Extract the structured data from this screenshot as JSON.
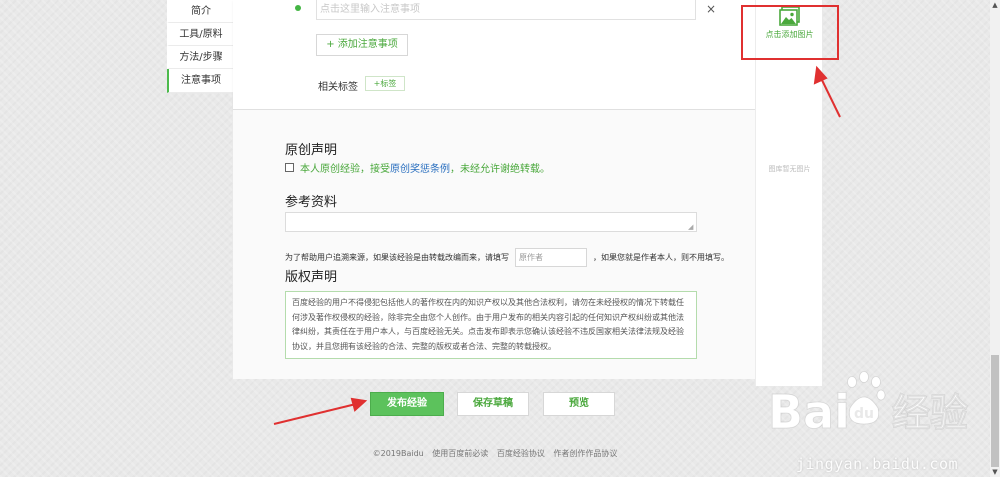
{
  "left_nav": {
    "items": [
      {
        "label": "简介"
      },
      {
        "label": "工具/原料"
      },
      {
        "label": "方法/步骤"
      },
      {
        "label": "注意事项"
      }
    ]
  },
  "editor": {
    "note_placeholder": "点击这里输入注意事项",
    "close_glyph": "×",
    "add_note_label": "+ 添加注意事项",
    "tags_label": "相关标签",
    "add_tag_label": "+标签"
  },
  "original": {
    "title": "原创声明",
    "text_before": "本人原创经验，接受",
    "link_text": "原创奖惩条例",
    "text_after": "，未经允许谢绝转载。"
  },
  "reference": {
    "title": "参考资料",
    "source_before": "为了帮助用户追溯来源，如果该经验是由转载改编而来，请填写",
    "author_placeholder": "原作者",
    "source_after": "，如果您就是作者本人，则不用填写。"
  },
  "copyright": {
    "title": "版权声明",
    "text": "百度经验的用户不得侵犯包括他人的著作权在内的知识产权以及其他合法权利，请勿在未经授权的情况下转载任何涉及著作权侵权的经验，除非完全由您个人创作。由于用户发布的相关内容引起的任何知识产权纠纷或其他法律纠纷，其责任在于用户本人，与百度经验无关。点击发布即表示您确认该经验不违反国家相关法律法规及经验协议，并且您拥有该经验的合法、完整的版权或者合法、完整的转载授权。"
  },
  "sidebar": {
    "add_image_label": "点击添加图片",
    "no_image_text": "图库暂无图片"
  },
  "buttons": {
    "publish": "发布经验",
    "draft": "保存草稿",
    "preview": "预览"
  },
  "footer": {
    "copyright": "©2019Baidu",
    "links": [
      "使用百度前必读",
      "百度经验协议",
      "作者创作作品协议"
    ]
  },
  "watermark": {
    "brand": "Bai",
    "brand_suffix": "经验",
    "url": "jingyan.baidu.com"
  },
  "colors": {
    "accent_green": "#4aa83c",
    "button_green": "#5cc25c",
    "link_blue": "#2a6fbf",
    "annotation_red": "#e03030"
  },
  "icons": {
    "add_image": "image-icon",
    "close": "close-icon",
    "checkbox": "checkbox-icon",
    "watermark_paw": "paw-icon"
  }
}
